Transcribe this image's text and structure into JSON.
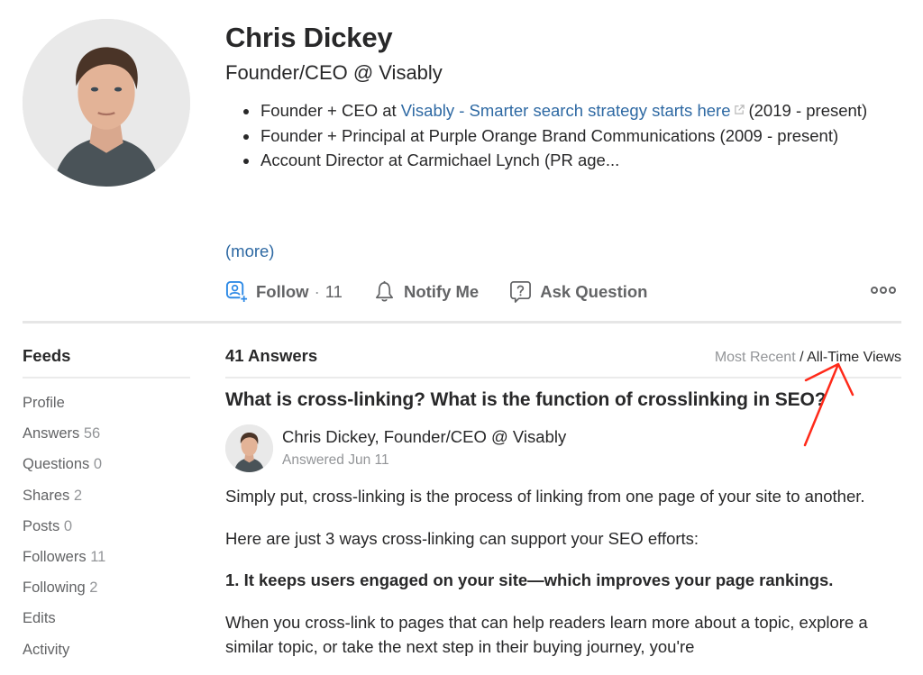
{
  "profile": {
    "name": "Chris Dickey",
    "tagline": "Founder/CEO @ Visably",
    "credentials": [
      {
        "prefix": "Founder + CEO at ",
        "link": "Visably - Smarter search strategy starts here",
        "suffix": "(2019 - present)"
      },
      {
        "prefix": "Founder + Principal at Purple Orange Brand Communications (2009 - present)"
      },
      {
        "prefix": "Account Director at Carmichael Lynch (PR age..."
      }
    ],
    "more_label": "(more)",
    "avatar_icon": "profile-photo"
  },
  "actions": {
    "follow_label": "Follow",
    "follow_sep": "·",
    "follow_count": "11",
    "notify_label": "Notify Me",
    "ask_label": "Ask Question",
    "overflow_icon": "more-horizontal-icon"
  },
  "sidebar": {
    "title": "Feeds",
    "items": [
      {
        "label": "Profile",
        "count": ""
      },
      {
        "label": "Answers",
        "count": "56"
      },
      {
        "label": "Questions",
        "count": "0"
      },
      {
        "label": "Shares",
        "count": "2"
      },
      {
        "label": "Posts",
        "count": "0"
      },
      {
        "label": "Followers",
        "count": " 11"
      },
      {
        "label": "Following",
        "count": " 2"
      },
      {
        "label": "Edits",
        "count": ""
      },
      {
        "label": "Activity",
        "count": ""
      }
    ]
  },
  "answers": {
    "count_label": "41 Answers",
    "sort_inactive": "Most Recent",
    "sort_sep": " / ",
    "sort_active": "All-Time Views"
  },
  "question": {
    "title": "What is cross-linking? What is the function of crosslinking in SEO?",
    "author": "Chris Dickey, Founder/CEO @ Visably",
    "answered": "Answered Jun 11",
    "paragraphs": [
      "Simply put, cross-linking is the process of linking from one page of your site to another.",
      "Here are just 3 ways cross-linking can support your SEO efforts:",
      "1. It keeps users engaged on your site—which improves your page rankings.",
      "When you cross-link to pages that can help readers learn more about a topic, explore a similar topic, or take the next step in their buying journey, you're"
    ]
  },
  "colors": {
    "link": "#2e69a3",
    "follow_accent": "#2e8ae6",
    "annotation_arrow": "#ff2a1a"
  }
}
